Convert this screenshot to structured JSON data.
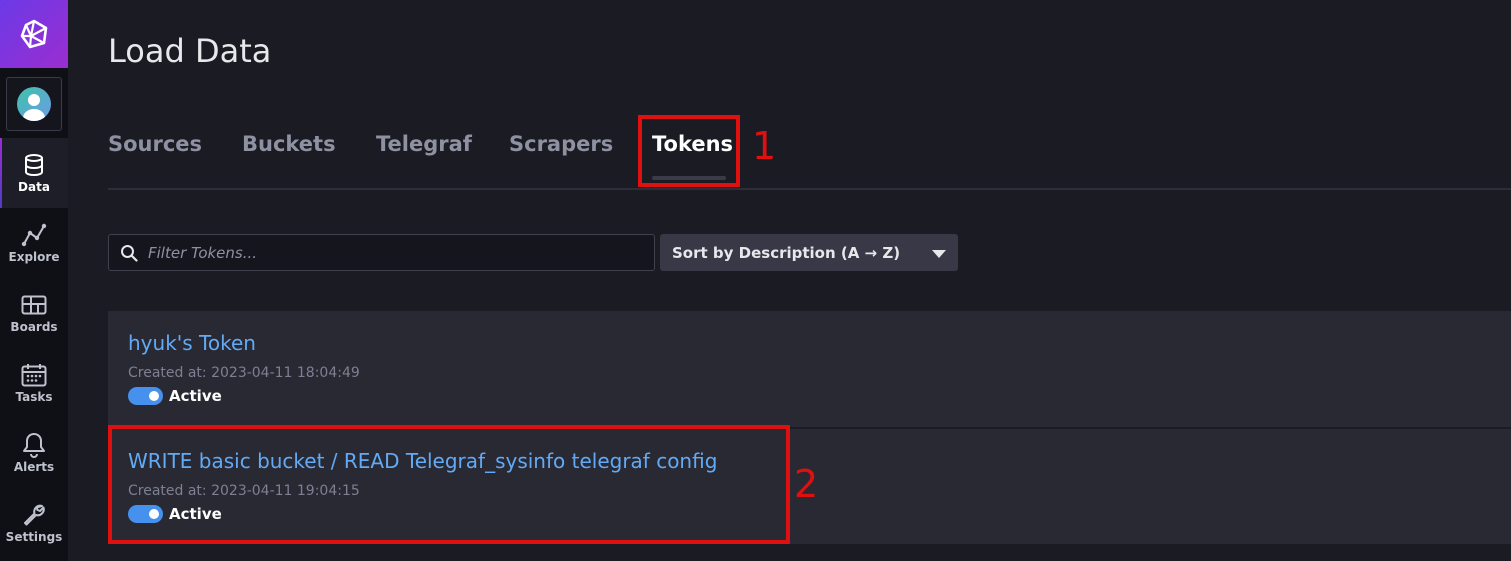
{
  "sidebar": {
    "items": [
      {
        "label": "Data",
        "icon": "database-icon"
      },
      {
        "label": "Explore",
        "icon": "graph-icon"
      },
      {
        "label": "Boards",
        "icon": "dashboard-icon"
      },
      {
        "label": "Tasks",
        "icon": "calendar-icon"
      },
      {
        "label": "Alerts",
        "icon": "bell-icon"
      },
      {
        "label": "Settings",
        "icon": "wrench-icon"
      }
    ]
  },
  "page": {
    "title": "Load Data"
  },
  "tabs": [
    {
      "label": "Sources"
    },
    {
      "label": "Buckets"
    },
    {
      "label": "Telegraf"
    },
    {
      "label": "Scrapers"
    },
    {
      "label": "Tokens"
    }
  ],
  "filter": {
    "placeholder": "Filter Tokens..."
  },
  "sort": {
    "label": "Sort by Description (A → Z)"
  },
  "tokens": [
    {
      "title": "hyuk's Token",
      "created": "Created at: 2023-04-11 18:04:49",
      "status": "Active"
    },
    {
      "title": "WRITE basic bucket / READ Telegraf_sysinfo telegraf config",
      "created": "Created at: 2023-04-11 19:04:15",
      "status": "Active"
    }
  ],
  "annotations": [
    "1",
    "2"
  ],
  "colors": {
    "accent": "#62aaf6",
    "annotation": "#e01010",
    "toggle": "#4591ed"
  }
}
